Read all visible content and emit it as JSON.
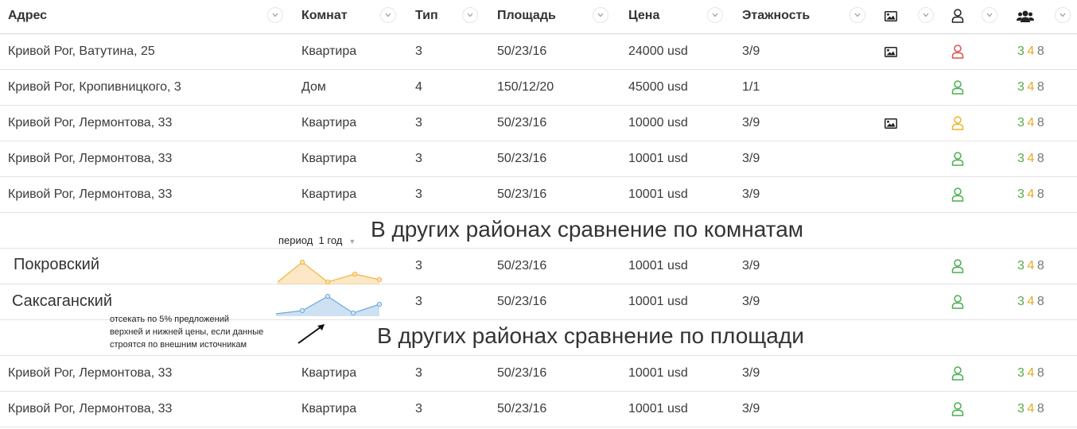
{
  "columns": [
    {
      "label": "Адрес"
    },
    {
      "label": "Комнат"
    },
    {
      "label": "Тип"
    },
    {
      "label": "Площадь"
    },
    {
      "label": "Цена"
    },
    {
      "label": "Этажность"
    }
  ],
  "header_icons": [
    "image-icon",
    "user-icon",
    "users-icon"
  ],
  "colors": {
    "rating_green": "#5ba84a",
    "rating_orange": "#e8a820",
    "rating_gray": "#777777",
    "status_red": "#d9534f",
    "status_green": "#4caf50",
    "status_yellow": "#f0b429",
    "chart_orange": "#f5b342",
    "chart_blue": "#6fa8dc"
  },
  "rows_top": [
    {
      "address": "Кривой Рог, Ватутина, 25",
      "rooms": "Квартира",
      "type": "3",
      "area": "50/23/16",
      "price": "24000 usd",
      "floors": "3/9",
      "has_photo": true,
      "status": "red"
    },
    {
      "address": "Кривой Рог, Кропивницкого, 3",
      "rooms": "Дом",
      "type": "4",
      "area": "150/12/20",
      "price": "45000 usd",
      "floors": "1/1",
      "has_photo": false,
      "status": "green"
    },
    {
      "address": "Кривой Рог, Лермонтова, 33",
      "rooms": "Квартира",
      "type": "3",
      "area": "50/23/16",
      "price": "10000 usd",
      "floors": "3/9",
      "has_photo": true,
      "status": "yellow"
    },
    {
      "address": "Кривой Рог, Лермонтова, 33",
      "rooms": "Квартира",
      "type": "3",
      "area": "50/23/16",
      "price": "10001 usd",
      "floors": "3/9",
      "has_photo": false,
      "status": "green"
    },
    {
      "address": "Кривой Рог, Лермонтова, 33",
      "rooms": "Квартира",
      "type": "3",
      "area": "50/23/16",
      "price": "10001 usd",
      "floors": "3/9",
      "has_photo": false,
      "status": "green"
    }
  ],
  "section_rooms": {
    "title": "В других районах сравнение по комнатам",
    "period_label": "период",
    "period_value": "1 год",
    "districts": [
      {
        "name": "Покровский",
        "type": "3",
        "area": "50/23/16",
        "price": "10001 usd",
        "floors": "3/9",
        "status": "green"
      },
      {
        "name": "Саксаганский",
        "type": "3",
        "area": "50/23/16",
        "price": "10001 usd",
        "floors": "3/9",
        "status": "green"
      }
    ],
    "note_lines": [
      "отсекать по 5% предложений",
      "верхней и нижней цены, если данные",
      "строятся по внешним источникам"
    ]
  },
  "section_area": {
    "title": "В других районах сравнение по площади"
  },
  "rows_bottom": [
    {
      "address": "Кривой Рог, Лермонтова, 33",
      "rooms": "Квартира",
      "type": "3",
      "area": "50/23/16",
      "price": "10001 usd",
      "floors": "3/9",
      "status": "green"
    },
    {
      "address": "Кривой Рог, Лермонтова, 33",
      "rooms": "Квартира",
      "type": "3",
      "area": "50/23/16",
      "price": "10001 usd",
      "floors": "3/9",
      "status": "green"
    }
  ],
  "rating": [
    "3",
    "4",
    "8"
  ]
}
